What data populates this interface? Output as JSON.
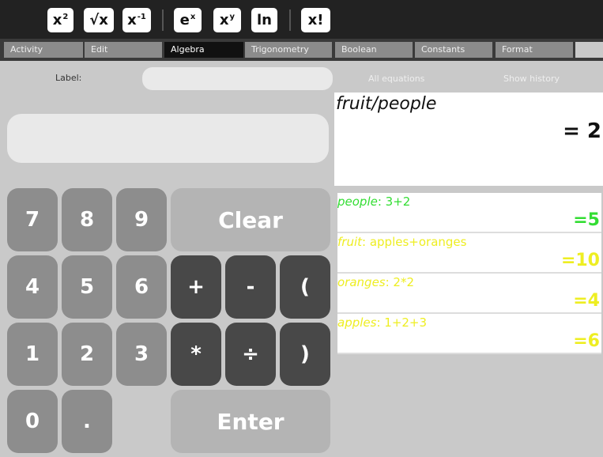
{
  "toolbar": {
    "buttons": [
      {
        "base": "x",
        "sup": "2",
        "name": "square-button"
      },
      {
        "base": "√x",
        "sup": "",
        "name": "sqrt-button"
      },
      {
        "base": "x",
        "sup": "-1",
        "name": "inverse-button"
      },
      {
        "base": "e",
        "sup": "x",
        "name": "exp-button"
      },
      {
        "base": "x",
        "sup": "y",
        "name": "power-button"
      },
      {
        "base": "ln",
        "sup": "",
        "name": "ln-button"
      },
      {
        "base": "x!",
        "sup": "",
        "name": "factorial-button"
      }
    ]
  },
  "tabs": [
    "Activity",
    "Edit",
    "Algebra",
    "Trigonometry",
    "Boolean",
    "Constants",
    "Format"
  ],
  "active_tab": "Algebra",
  "label_row": {
    "label_text": "Label:",
    "label_value": "",
    "all_equations": "All equations",
    "show_history": "Show history"
  },
  "entry": {
    "value": ""
  },
  "result": {
    "expression": "fruit/people",
    "value": "= 2"
  },
  "history": [
    {
      "name": "people",
      "expr": ": 3+2",
      "result": "=5",
      "color": "#33dd33"
    },
    {
      "name": "fruit",
      "expr": ": apples+oranges",
      "result": "=10",
      "color": "#eeee22"
    },
    {
      "name": "oranges",
      "expr": ": 2*2",
      "result": "=4",
      "color": "#eeee22"
    },
    {
      "name": "apples",
      "expr": ": 1+2+3",
      "result": "=6",
      "color": "#eeee22"
    }
  ],
  "keypad": {
    "k7": "7",
    "k8": "8",
    "k9": "9",
    "k4": "4",
    "k5": "5",
    "k6": "6",
    "k1": "1",
    "k2": "2",
    "k3": "3",
    "k0": "0",
    "kdot": ".",
    "plus": "+",
    "minus": "-",
    "lparen": "(",
    "times": "*",
    "divide": "÷",
    "rparen": ")",
    "clear": "Clear",
    "enter": "Enter"
  }
}
